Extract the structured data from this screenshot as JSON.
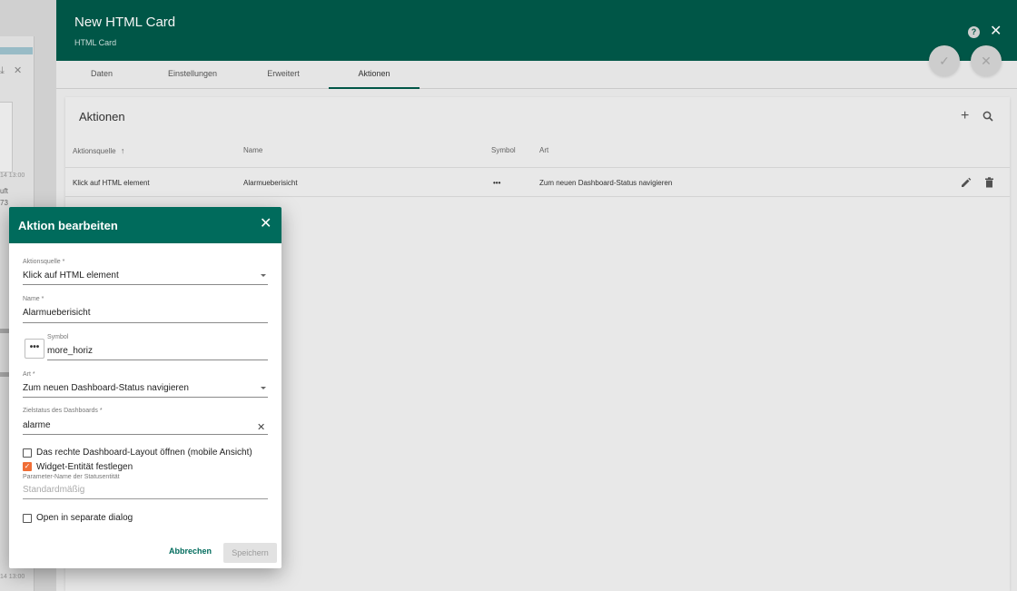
{
  "background": {
    "left_labels": [
      "uft",
      "73"
    ],
    "timestamps": [
      "14 13:00",
      "14 13:00"
    ]
  },
  "editor": {
    "title": "New HTML Card",
    "subtitle": "HTML Card",
    "help_icon": "?",
    "close_icon": "✕",
    "fab_apply_icon": "✓",
    "fab_cancel_icon": "✕"
  },
  "tabs": [
    {
      "label": "Daten"
    },
    {
      "label": "Einstellungen"
    },
    {
      "label": "Erweitert"
    },
    {
      "label": "Aktionen",
      "active": true
    }
  ],
  "actions_card": {
    "title": "Aktionen",
    "add_icon": "+",
    "columns": {
      "source": "Aktionsquelle",
      "sort_icon": "↑",
      "name": "Name",
      "symbol": "Symbol",
      "type": "Art"
    },
    "rows": [
      {
        "source": "Klick auf HTML element",
        "name": "Alarmueberisicht",
        "symbol": "•••",
        "type": "Zum neuen Dashboard-Status navigieren"
      }
    ]
  },
  "dialog": {
    "title": "Aktion bearbeiten",
    "close_icon": "✕",
    "source": {
      "label": "Aktionsquelle *",
      "value": "Klick auf HTML element"
    },
    "name": {
      "label": "Name *",
      "value": "Alarmueberisicht"
    },
    "symbol": {
      "label": "Symbol",
      "value": "more_horiz",
      "button_glyph": "•••"
    },
    "type": {
      "label": "Art *",
      "value": "Zum neuen Dashboard-Status navigieren"
    },
    "target_state": {
      "label": "Zielstatus des Dashboards *",
      "value": "alarme",
      "clear_icon": "✕"
    },
    "open_right_layout": {
      "label": "Das rechte Dashboard-Layout öffnen (mobile Ansicht)",
      "checked": false
    },
    "set_entity": {
      "label": "Widget-Entität festlegen",
      "checked": true,
      "check_glyph": "✓"
    },
    "param_name": {
      "label": "Parameter-Name der Statusentität",
      "placeholder": "Standardmäßig"
    },
    "separate_dialog": {
      "label": "Open in separate dialog",
      "checked": false
    },
    "cancel_label": "Abbrechen",
    "save_label": "Speichern"
  },
  "colors": {
    "header": "#005a4a",
    "dialog_header": "#006b5c",
    "checkbox_accent": "#f06d35"
  }
}
